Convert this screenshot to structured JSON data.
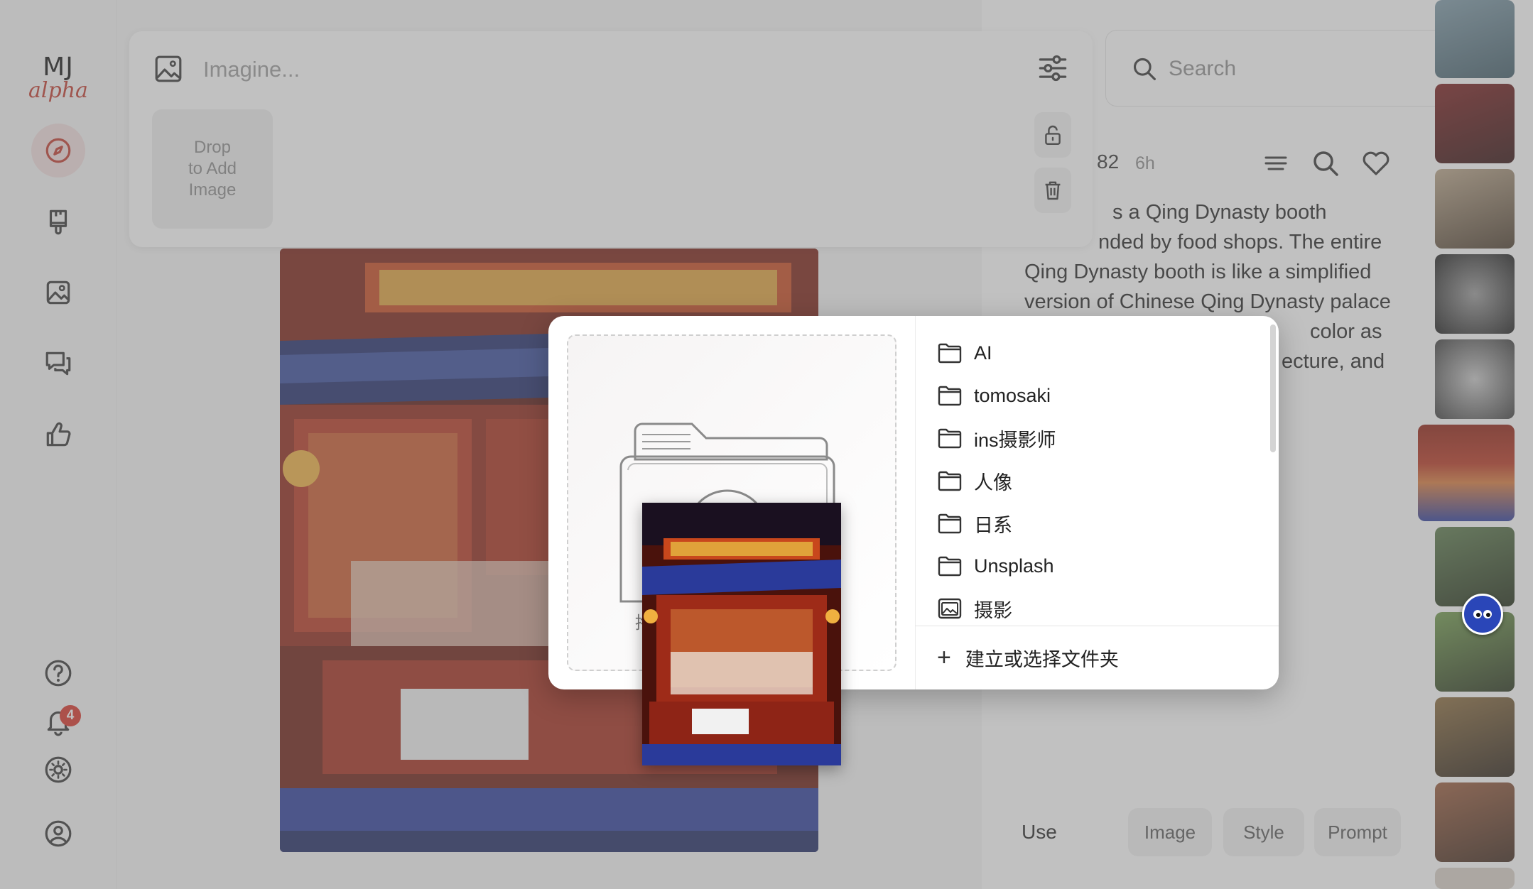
{
  "logo": {
    "line1": "MJ",
    "line2": "alpha"
  },
  "sidebar": {
    "notification_count": "4"
  },
  "prompt": {
    "placeholder": "Imagine...",
    "drop_line1": "Drop",
    "drop_line2": "to Add",
    "drop_line3": "Image"
  },
  "search": {
    "placeholder": "Search"
  },
  "detail": {
    "meta_number": "82",
    "meta_time": "6h",
    "description_lines": [
      "s a Qing Dynasty booth",
      "nded by food shops. The entire",
      "Qing Dynasty booth is like a simplified",
      "version of Chinese Qing Dynasty palace",
      "color as",
      "ecture, and"
    ],
    "use_label": "Use",
    "use_buttons": [
      "Image",
      "Style",
      "Prompt"
    ]
  },
  "dialog": {
    "folders": [
      "AI",
      "tomosaki",
      "ins摄影师",
      "人像",
      "日系",
      "Unsplash",
      "摄影"
    ],
    "footer_label": "建立或选择文件夹",
    "drop_hint": "拖"
  },
  "colors": {
    "accent_red": "#c0392b",
    "badge_red": "#d93025",
    "overlay": "rgba(120,120,120,0.46)"
  }
}
